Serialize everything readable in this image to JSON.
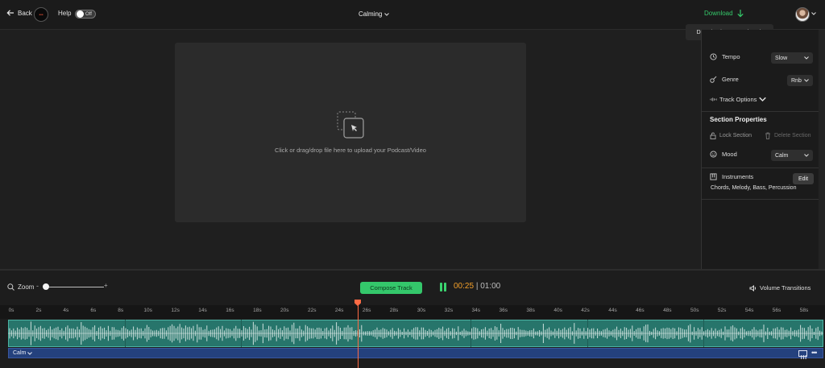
{
  "topbar": {
    "back_label": "Back",
    "help_label": "Help",
    "help_toggle": "Off",
    "track_name": "Calming",
    "download_label": "Download",
    "tooltip": "Download generated track"
  },
  "upload": {
    "text": "Click or drag/drop file here to upload your Podcast/Video"
  },
  "panel": {
    "tempo_label": "Tempo",
    "tempo_value": "Slow",
    "genre_label": "Genre",
    "genre_value": "Rnb",
    "track_options_label": "Track Options",
    "section_properties": "Section Properties",
    "lock_section": "Lock Section",
    "delete_section": "Delete Section",
    "mood_label": "Mood",
    "mood_value": "Calm",
    "instruments_label": "Instruments",
    "edit_label": "Edit",
    "instruments_list": "Chords, Melody, Bass, Percussion"
  },
  "controls": {
    "zoom_label": "Zoom",
    "zoom_minus": "-",
    "zoom_plus": "+",
    "compose_label": "Compose Track",
    "time_current": "00:25",
    "time_separator": "|",
    "time_total": "01:00",
    "volume_transitions": "Volume Transitions"
  },
  "timeline": {
    "ticks": [
      "0s",
      "2s",
      "4s",
      "6s",
      "8s",
      "10s",
      "12s",
      "14s",
      "16s",
      "18s",
      "20s",
      "22s",
      "24s",
      "26s",
      "28s",
      "30s",
      "32s",
      "34s",
      "36s",
      "38s",
      "40s",
      "42s",
      "44s",
      "46s",
      "48s",
      "50s",
      "52s",
      "54s",
      "56s",
      "58s"
    ],
    "section_label": "Calm",
    "playhead_seconds": 25,
    "duration_seconds": 60
  },
  "colors": {
    "accent_green": "#34c76b",
    "time_orange": "#f4a02a",
    "playhead": "#ff6b45",
    "track_teal": "#27756b",
    "label_blue": "#24417d"
  },
  "icons": {
    "back": "arrow-left-icon",
    "download": "arrow-down-icon",
    "tempo": "clock-icon",
    "genre": "guitar-icon",
    "track_options": "waveform-icon",
    "lock": "lock-icon",
    "delete": "trash-icon",
    "mood": "smiley-icon",
    "instruments": "piano-icon",
    "zoom": "search-icon",
    "volume": "speaker-icon",
    "upload": "upload-cursor-icon"
  }
}
